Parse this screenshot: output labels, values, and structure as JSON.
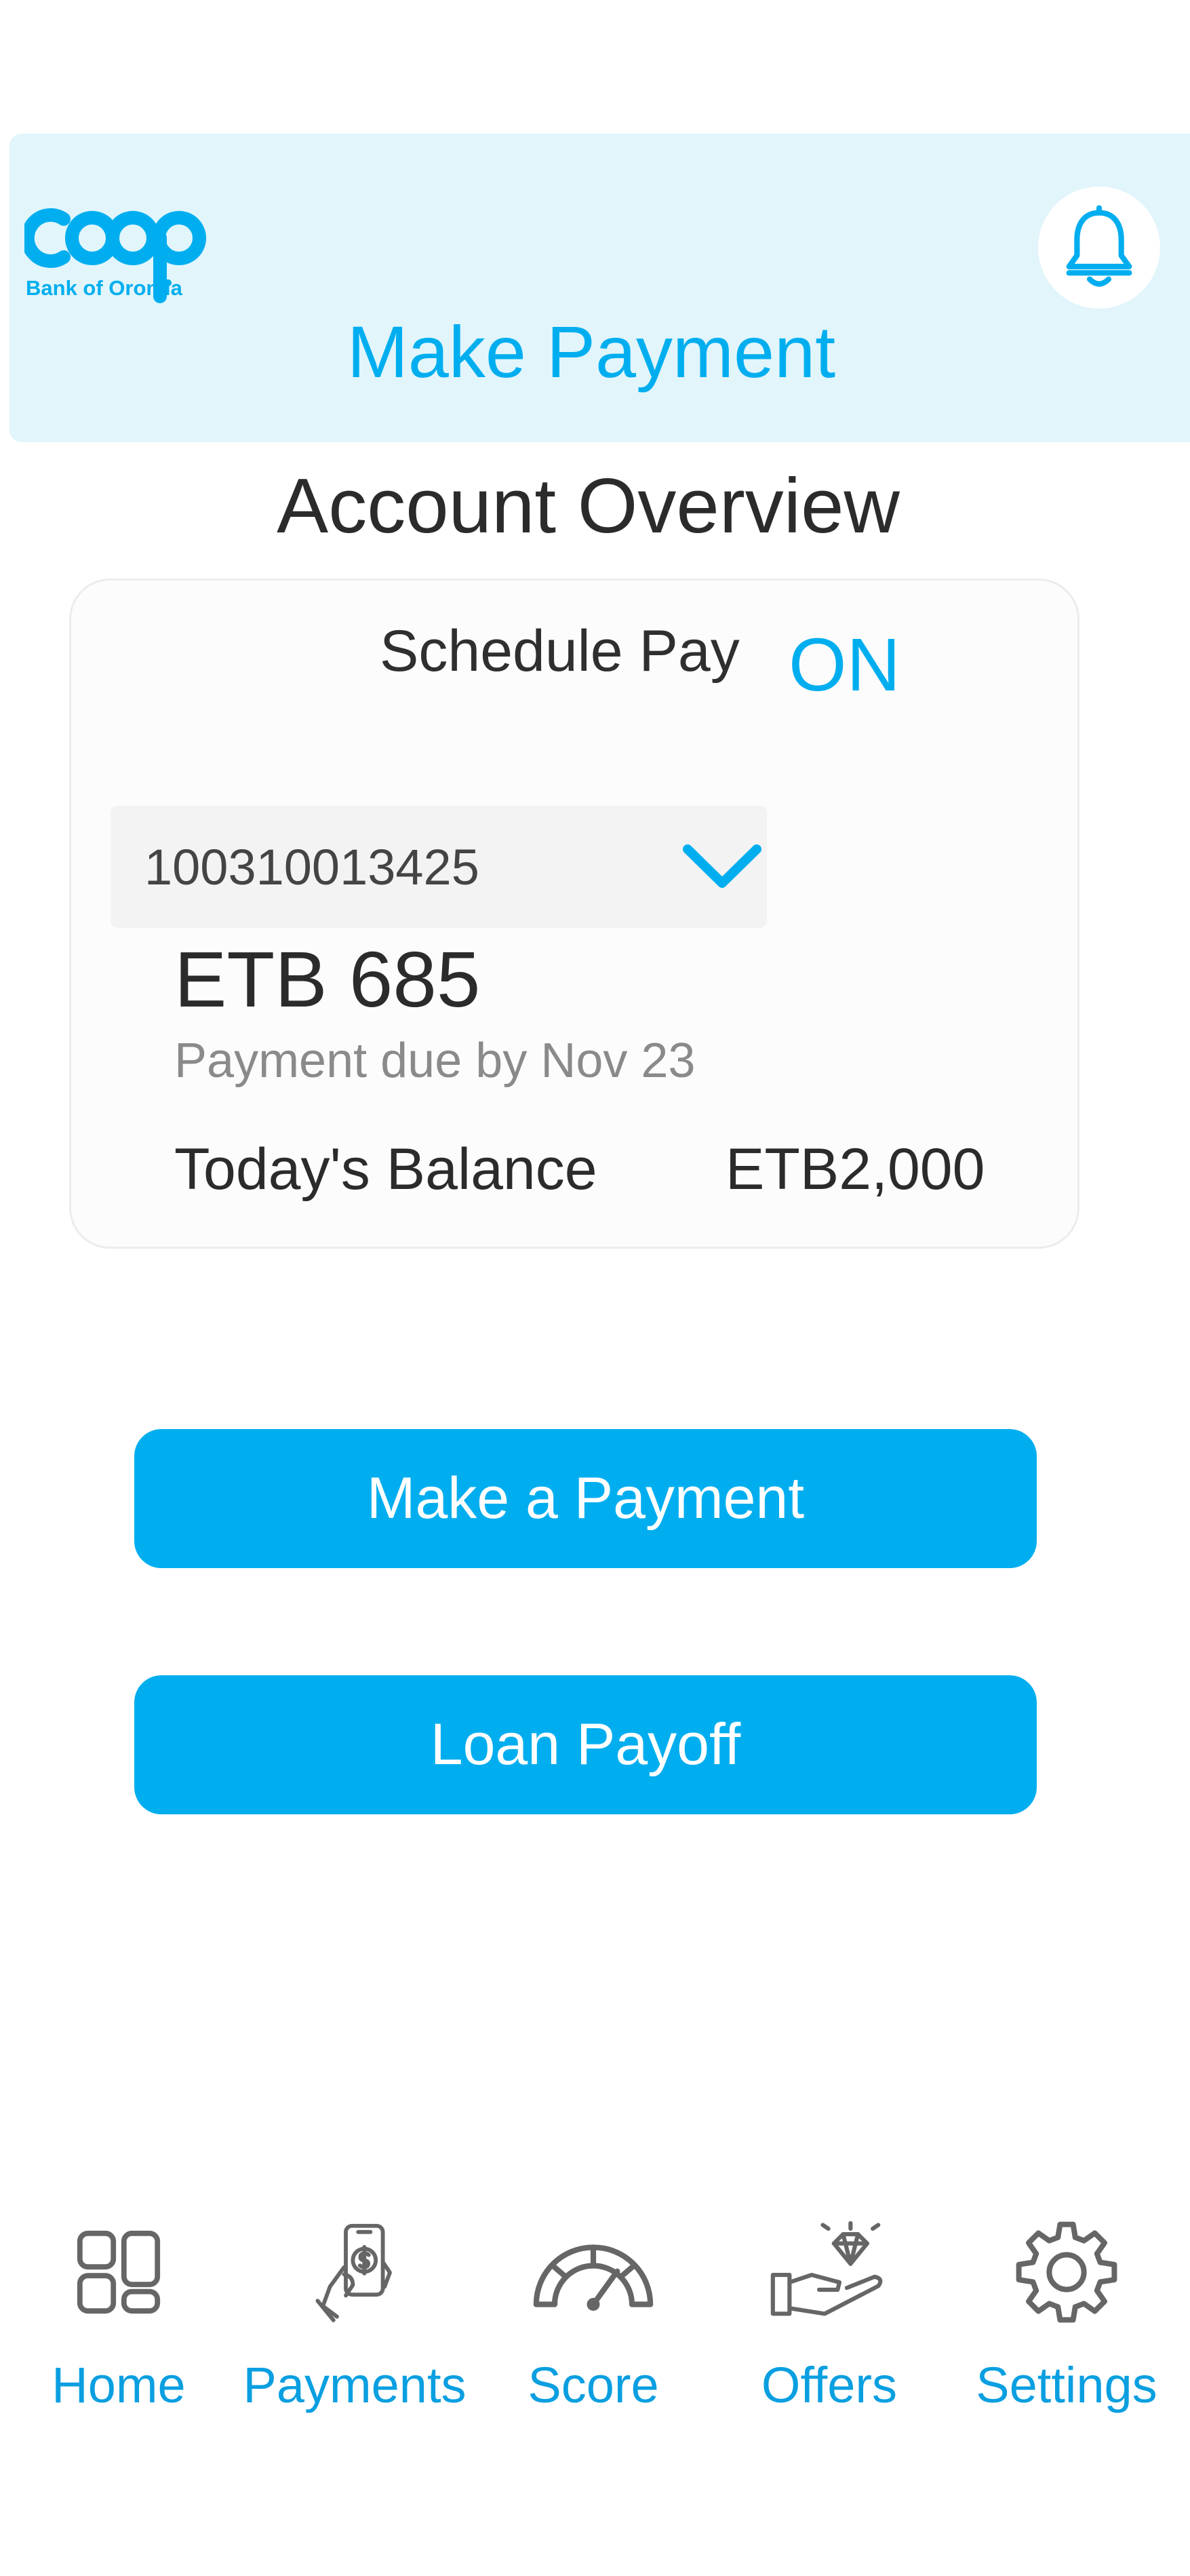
{
  "header": {
    "logo_text": "COOP",
    "logo_subtext": "Bank of Oromia",
    "title": "Make Payment"
  },
  "section_title": "Account Overview",
  "card": {
    "schedule_pay_label": "Schedule Pay",
    "schedule_pay_state": "ON",
    "account_number": "100310013425",
    "amount": "ETB 685",
    "due_text": "Payment due by Nov 23",
    "balance_label": "Today's Balance",
    "balance_value": "ETB2,000"
  },
  "actions": {
    "make_payment_label": "Make a Payment",
    "loan_payoff_label": "Loan Payoff"
  },
  "bottom_nav": [
    {
      "label": "Home",
      "icon": "home-grid-icon"
    },
    {
      "label": "Payments",
      "icon": "phone-payment-icon"
    },
    {
      "label": "Score",
      "icon": "gauge-icon"
    },
    {
      "label": "Offers",
      "icon": "diamond-hand-icon"
    },
    {
      "label": "Settings",
      "icon": "gear-icon"
    }
  ],
  "colors": {
    "accent": "#00aeef",
    "header_bg": "#e1f5fb",
    "text": "#2b2b2b",
    "muted": "#8a8a8a"
  }
}
